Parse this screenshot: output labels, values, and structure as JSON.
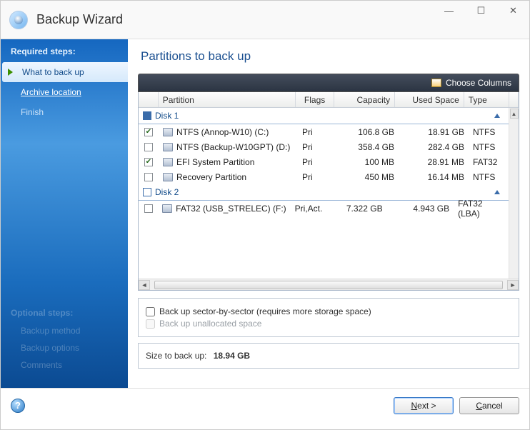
{
  "window": {
    "title": "Backup Wizard"
  },
  "sidebar": {
    "section_title": "Required steps:",
    "steps": [
      {
        "label": "What to back up",
        "state": "active"
      },
      {
        "label": "Archive location",
        "state": "link"
      },
      {
        "label": "Finish",
        "state": "dim"
      }
    ],
    "optional_title": "Optional steps:",
    "optional_items": [
      "Backup method",
      "Backup options",
      "Comments"
    ]
  },
  "main": {
    "heading": "Partitions to back up",
    "choose_columns": "Choose Columns",
    "columns": {
      "partition": "Partition",
      "flags": "Flags",
      "capacity": "Capacity",
      "used": "Used Space",
      "type": "Type"
    },
    "disks": [
      {
        "name": "Disk 1",
        "group_checked": "filled",
        "rows": [
          {
            "checked": true,
            "name": "NTFS (Annop-W10) (C:)",
            "flags": "Pri",
            "capacity": "106.8 GB",
            "used": "18.91 GB",
            "type": "NTFS"
          },
          {
            "checked": false,
            "name": "NTFS (Backup-W10GPT) (D:)",
            "flags": "Pri",
            "capacity": "358.4 GB",
            "used": "282.4 GB",
            "type": "NTFS"
          },
          {
            "checked": true,
            "name": "EFI System Partition",
            "flags": "Pri",
            "capacity": "100 MB",
            "used": "28.91 MB",
            "type": "FAT32"
          },
          {
            "checked": false,
            "name": "Recovery Partition",
            "flags": "Pri",
            "capacity": "450 MB",
            "used": "16.14 MB",
            "type": "NTFS"
          }
        ]
      },
      {
        "name": "Disk 2",
        "group_checked": "empty",
        "rows": [
          {
            "checked": false,
            "name": "FAT32 (USB_STRELEC) (F:)",
            "flags": "Pri,Act.",
            "capacity": "7.322 GB",
            "used": "4.943 GB",
            "type": "FAT32 (LBA)"
          }
        ]
      }
    ],
    "options": {
      "sector": "Back up sector-by-sector (requires more storage space)",
      "unalloc": "Back up unallocated space"
    },
    "size_label": "Size to back up:",
    "size_value": "18.94 GB"
  },
  "footer": {
    "next": "Next >",
    "cancel": "Cancel"
  }
}
